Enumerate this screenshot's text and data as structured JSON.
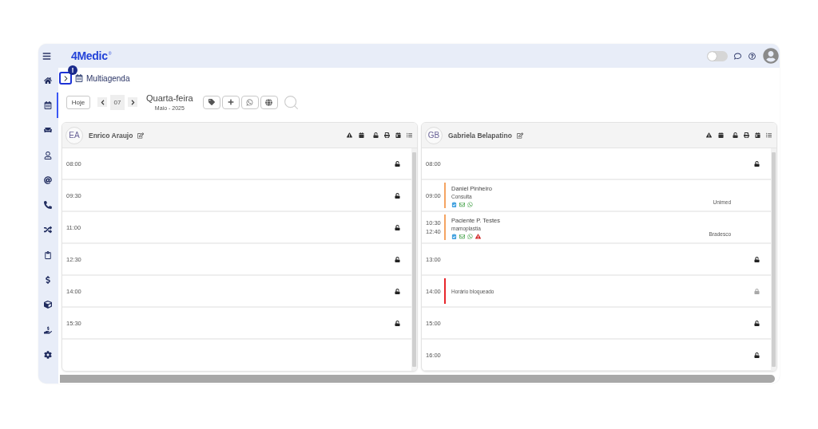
{
  "top_bar": {
    "logo": "4Medic$^{®}$",
    "toggle": {
      "on": false
    }
  },
  "sidebar": {
    "items": [
      {
        "selected": false
      },
      {
        "selected": true
      },
      {
        "selected": false
      },
      {
        "selected": false
      },
      {
        "selected": false
      },
      {
        "selected": false
      },
      {
        "selected": false
      },
      {
        "selected": false
      },
      {
        "selected": false
      },
      {
        "selected": false
      },
      {
        "selected": false
      },
      {
        "selected": false
      }
    ]
  },
  "breadcrumb": {
    "badge": "!",
    "title": "Multiagenda"
  },
  "date_nav": {
    "today_button": "Hoje",
    "day": "07",
    "weekday": "Quarta-feira",
    "month_year": "Maio - 2025"
  },
  "professionals": [
    {
      "initials": "EA",
      "name": "Enrico Araujo",
      "slots": [
        {
          "kind": "free",
          "time": "08:00"
        },
        {
          "kind": "free",
          "time": "09:30"
        },
        {
          "kind": "free",
          "time": "11:00"
        },
        {
          "kind": "free",
          "time": "12:30"
        },
        {
          "kind": "free",
          "time": "14:00"
        },
        {
          "kind": "free",
          "time": "15:30"
        }
      ]
    },
    {
      "initials": "GB",
      "name": "Gabriela Belapatino",
      "slots": [
        {
          "kind": "free",
          "time": "08:00"
        },
        {
          "kind": "appointment",
          "time": "09:00",
          "patient": "Daniel Pinheiro",
          "procedure": "Consulta",
          "insurance": "Unimed",
          "color": "#f5a462",
          "alert": false
        },
        {
          "kind": "appointment",
          "time": "10:30",
          "end_time": "12:40",
          "patient": "Paciente P. Testes",
          "procedure": "mamoplastia",
          "insurance": "Bradesco",
          "color": "#f5a462",
          "alert": true
        },
        {
          "kind": "free",
          "time": "13:00"
        },
        {
          "kind": "blocked",
          "time": "14:00",
          "label": "Horário bloqueado",
          "color": "#e8262b"
        },
        {
          "kind": "free",
          "time": "15:00"
        },
        {
          "kind": "free",
          "time": "16:00"
        }
      ]
    }
  ]
}
